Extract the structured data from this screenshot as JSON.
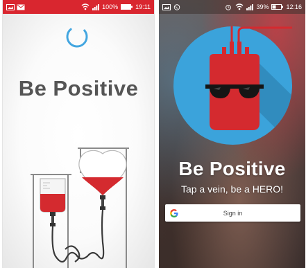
{
  "splash_screen": {
    "status_bar": {
      "battery_percent": "100%",
      "time": "19:11"
    },
    "title": "Be Positive"
  },
  "login_screen": {
    "status_bar": {
      "battery_percent": "39%",
      "time": "12:16"
    },
    "title": "Be Positive",
    "tagline": "Tap a vein, be a HERO!",
    "signin_button": {
      "label": "Sign in",
      "icon": "google-icon"
    }
  },
  "colors": {
    "status_bar_red": "#d9262f",
    "title_gray": "#555555",
    "spinner_blue": "#43a6e0",
    "logo_circle_blue": "#3ba3db",
    "blood_red": "#d42a2f"
  }
}
